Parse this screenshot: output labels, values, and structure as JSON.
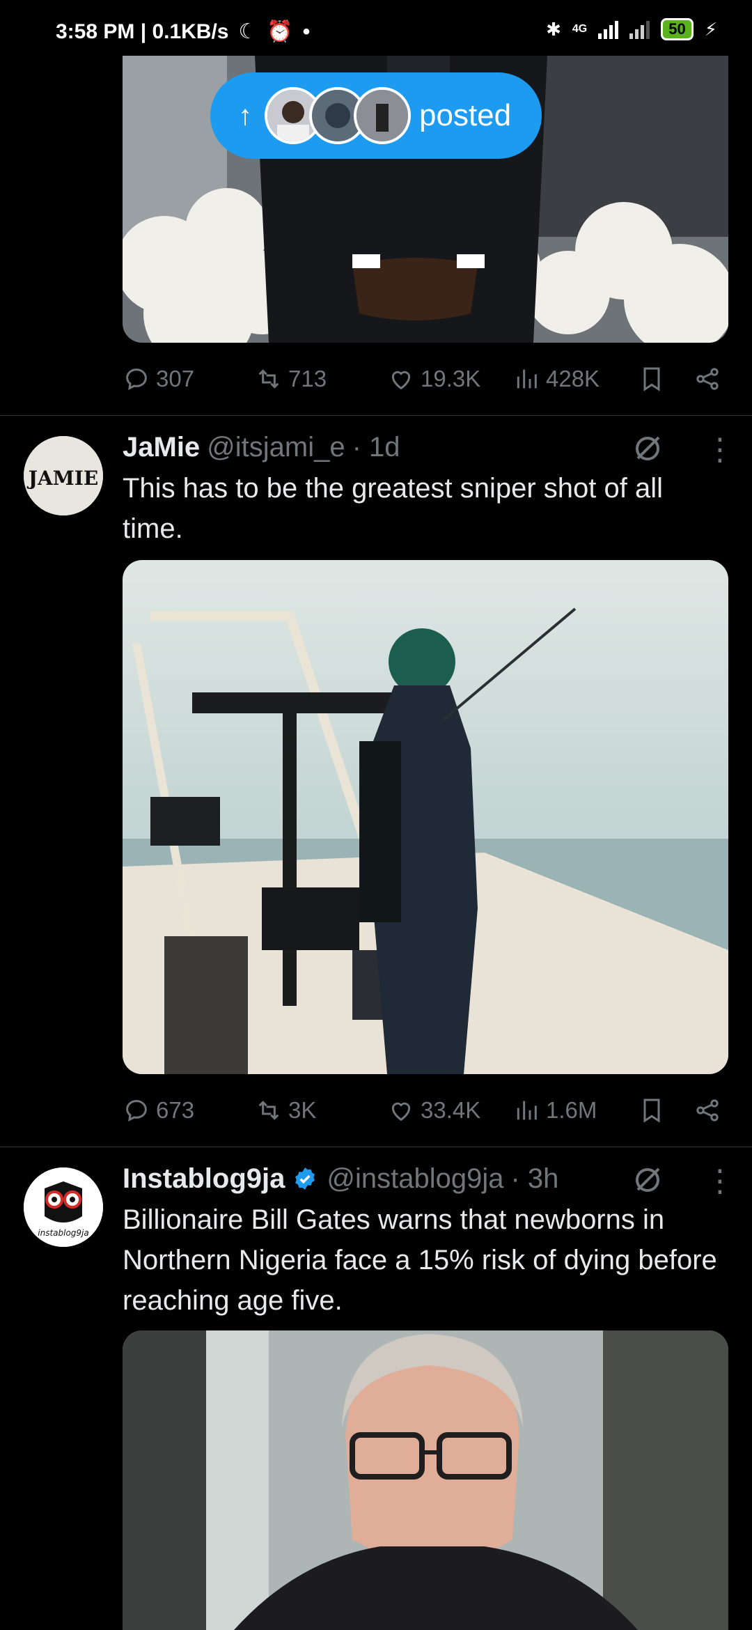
{
  "status": {
    "time_speed": "3:58 PM | 0.1KB/s",
    "network": "4G",
    "battery": "50"
  },
  "posted_pill": {
    "label": "posted"
  },
  "tweet1": {
    "stats": {
      "replies": "307",
      "reposts": "713",
      "likes": "19.3K",
      "views": "428K"
    }
  },
  "tweet2": {
    "display_name": "JaMie",
    "handle": "@itsjami_e",
    "time": "· 1d",
    "avatar_text": "JAMIE",
    "text": "This has to be the greatest sniper shot of all time.",
    "stats": {
      "replies": "673",
      "reposts": "3K",
      "likes": "33.4K",
      "views": "1.6M"
    }
  },
  "tweet3": {
    "display_name": "Instablog9ja",
    "handle": "@instablog9ja",
    "time": "· 3h",
    "avatar_text": "instablog9ja",
    "text": "Billionaire Bill Gates warns that newborns in Northern Nigeria face a 15% risk of dying before reaching age five."
  },
  "colors": {
    "accent": "#1d9bf0",
    "muted": "#71767b",
    "text": "#e7e9ea"
  }
}
